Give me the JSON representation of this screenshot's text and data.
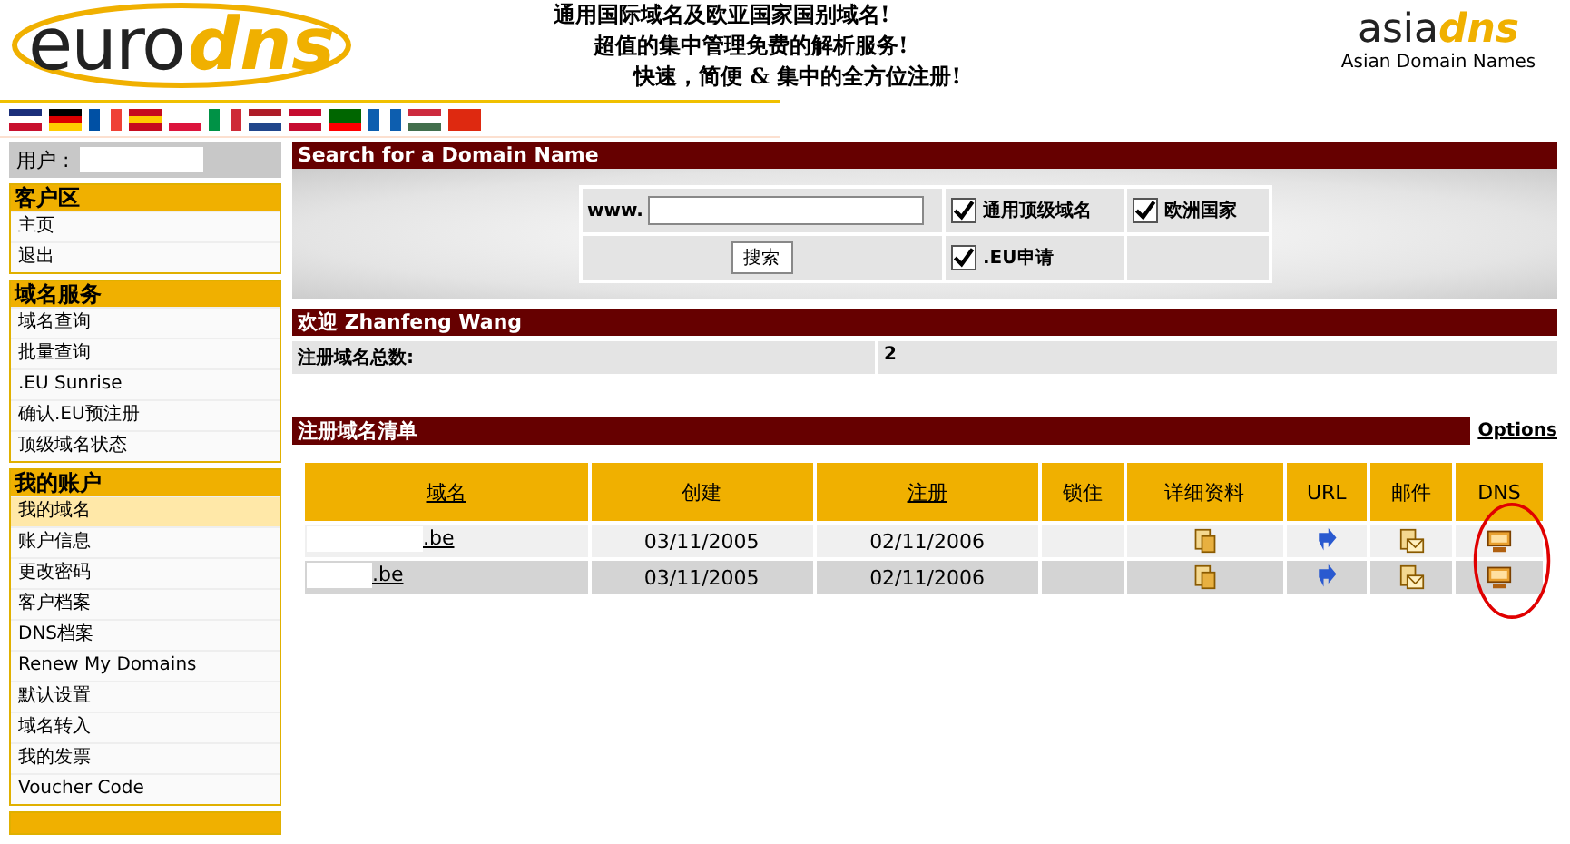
{
  "header": {
    "logo_left": {
      "part1": "euro",
      "part2": "dns"
    },
    "slogans": [
      "通用国际域名及欧亚国家国别域名!",
      "超值的集中管理免费的解析服务!",
      "快速，简便  & 集中的全方位注册!"
    ],
    "logo_right": {
      "part1": "asia",
      "part2": "dns",
      "tagline": "Asian Domain Names"
    }
  },
  "sidebar": {
    "user_label": "用户 :",
    "sections": [
      {
        "title": "客户区",
        "items": [
          {
            "label": "主页",
            "selected": false
          },
          {
            "label": "退出",
            "selected": false
          }
        ]
      },
      {
        "title": "域名服务",
        "items": [
          {
            "label": "域名查询",
            "selected": false
          },
          {
            "label": "批量查询",
            "selected": false
          },
          {
            "label": ".EU Sunrise",
            "selected": false
          },
          {
            "label": "确认.EU预注册",
            "selected": false
          },
          {
            "label": "顶级域名状态",
            "selected": false
          }
        ]
      },
      {
        "title": "我的账户",
        "items": [
          {
            "label": "我的域名",
            "selected": true
          },
          {
            "label": "账户信息",
            "selected": false
          },
          {
            "label": "更改密码",
            "selected": false
          },
          {
            "label": "客户档案",
            "selected": false
          },
          {
            "label": "DNS档案",
            "selected": false
          },
          {
            "label": "Renew My Domains",
            "selected": false
          },
          {
            "label": "默认设置",
            "selected": false
          },
          {
            "label": "域名转入",
            "selected": false
          },
          {
            "label": "我的发票",
            "selected": false
          },
          {
            "label": "Voucher Code",
            "selected": false
          }
        ]
      }
    ]
  },
  "search": {
    "title": "Search for a Domain Name",
    "prefix": "www.",
    "button": "搜索",
    "options": [
      {
        "label": "通用顶级域名",
        "checked": true
      },
      {
        "label": "欧洲国家",
        "checked": true
      },
      {
        "label": ".EU申请",
        "checked": true
      }
    ]
  },
  "welcome": {
    "title": "欢迎 Zhanfeng Wang",
    "count_label": "注册域名总数:",
    "count": "2"
  },
  "domains": {
    "title": "注册域名清单",
    "options_link": "Options",
    "columns": [
      {
        "label": "域名",
        "link": true
      },
      {
        "label": "创建",
        "link": false
      },
      {
        "label": "注册",
        "link": true
      },
      {
        "label": "锁住",
        "link": false
      },
      {
        "label": "详细资料",
        "link": false
      },
      {
        "label": "URL",
        "link": false
      },
      {
        "label": "邮件",
        "link": false
      },
      {
        "label": "DNS",
        "link": false
      }
    ],
    "rows": [
      {
        "domain": ".be",
        "created": "03/11/2005",
        "expires": "02/11/2006"
      },
      {
        "domain": ".be",
        "created": "03/11/2005",
        "expires": "02/11/2006"
      }
    ],
    "dns_highlighted": true
  }
}
